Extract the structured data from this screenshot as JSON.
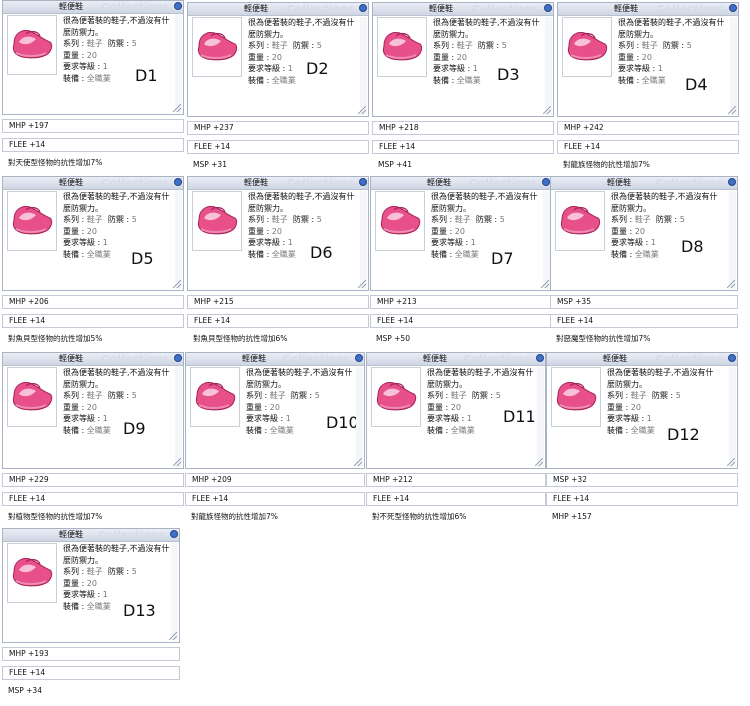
{
  "item": {
    "name": "輕便鞋",
    "watermark": "Collections",
    "desc1": "很為便著裝的鞋子,不過沒有什",
    "desc2": "麼防禦力。",
    "series_label": "系列 :",
    "series_value": "鞋子",
    "def_label": "防禦 :",
    "def_value": "5",
    "weight_label": "重量 :",
    "weight_value": "20",
    "level_label": "要求等級 :",
    "level_value": "1",
    "equip_label": "裝備 :",
    "equip_value": "全職業",
    "icon": "pink-shoe-icon"
  },
  "colors": {
    "border": "#aab3c4",
    "titlebar": "#cfd6e4",
    "close": "#3f6fc6",
    "shoe": "#e8508a"
  },
  "cards": [
    {
      "id": "D1",
      "options": [
        "MHP +197",
        "FLEE +14",
        "對天使型怪物的抗性增加7%"
      ]
    },
    {
      "id": "D2",
      "options": [
        "MHP +237",
        "FLEE +14",
        "MSP +31"
      ]
    },
    {
      "id": "D3",
      "options": [
        "MHP +218",
        "FLEE +14",
        "MSP +41"
      ]
    },
    {
      "id": "D4",
      "options": [
        "MHP +242",
        "FLEE +14",
        "對龍族怪物的抗性增加7%"
      ]
    },
    {
      "id": "D5",
      "options": [
        "MHP +206",
        "FLEE +14",
        "對魚貝型怪物的抗性增加5%"
      ]
    },
    {
      "id": "D6",
      "options": [
        "MHP +215",
        "FLEE +14",
        "對魚貝型怪物的抗性增加6%"
      ]
    },
    {
      "id": "D7",
      "options": [
        "MHP +213",
        "FLEE +14",
        "MSP +50"
      ]
    },
    {
      "id": "D8",
      "options": [
        "MSP +35",
        "FLEE +14",
        "對惡魔型怪物的抗性增加7%"
      ]
    },
    {
      "id": "D9",
      "options": [
        "MHP +229",
        "FLEE +14",
        "對植物型怪物的抗性增加7%"
      ]
    },
    {
      "id": "D10",
      "options": [
        "MHP +209",
        "FLEE +14",
        "對龍族怪物的抗性增加7%"
      ]
    },
    {
      "id": "D11",
      "options": [
        "MHP +212",
        "FLEE +14",
        "對不死型怪物的抗性增加6%"
      ]
    },
    {
      "id": "D12",
      "options": [
        "MSP +32",
        "FLEE +14",
        "MHP +157"
      ]
    },
    {
      "id": "D13",
      "options": [
        "MHP +193",
        "FLEE +14",
        "MSP +34"
      ]
    }
  ]
}
